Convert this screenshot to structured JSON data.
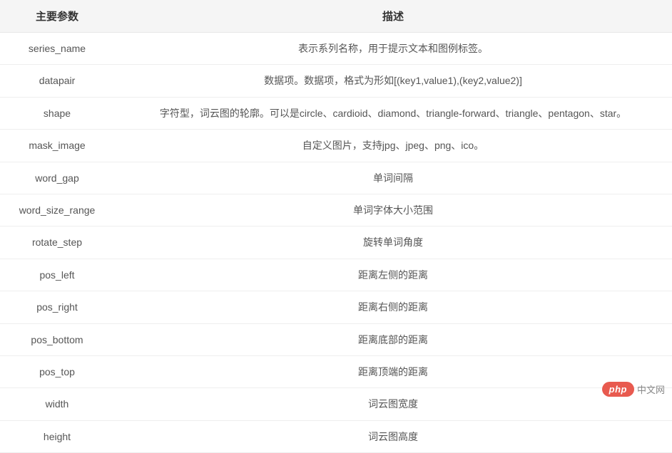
{
  "table": {
    "headers": {
      "param": "主要参数",
      "desc": "描述"
    },
    "rows": [
      {
        "param": "series_name",
        "desc": "表示系列名称，用于提示文本和图例标签。"
      },
      {
        "param": "datapair",
        "desc": "数据项。数据项，格式为形如[(key1,value1),(key2,value2)]"
      },
      {
        "param": "shape",
        "desc": "字符型，词云图的轮廓。可以是circle、cardioid、diamond、triangle-forward、triangle、pentagon、star。"
      },
      {
        "param": "mask_image",
        "desc": "自定义图片，支持jpg、jpeg、png、ico。"
      },
      {
        "param": "word_gap",
        "desc": "单词间隔"
      },
      {
        "param": "word_size_range",
        "desc": "单词字体大小范围"
      },
      {
        "param": "rotate_step",
        "desc": "旋转单词角度"
      },
      {
        "param": "pos_left",
        "desc": "距离左侧的距离"
      },
      {
        "param": "pos_right",
        "desc": "距离右侧的距离"
      },
      {
        "param": "pos_bottom",
        "desc": "距离底部的距离"
      },
      {
        "param": "pos_top",
        "desc": "距离顶端的距离"
      },
      {
        "param": "width",
        "desc": "词云图宽度"
      },
      {
        "param": "height",
        "desc": "词云图高度"
      }
    ]
  },
  "watermark": {
    "badge": "php",
    "text": "中文网"
  }
}
